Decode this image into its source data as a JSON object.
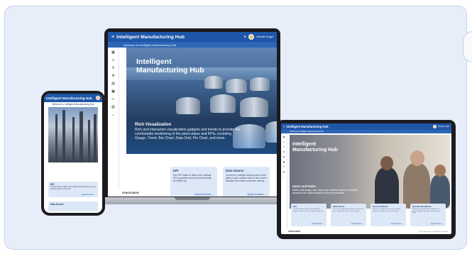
{
  "app": {
    "title": "Intelligent Manufacturing Hub",
    "welcome": "Welcome to Intelligent Manufacturing Hub",
    "user": "Jennifer Angel",
    "brand": "SYNCFUSION"
  },
  "laptop": {
    "sidebar_icons": [
      "▦",
      "⚠",
      "↯",
      "⚙",
      "▤",
      "▣",
      "⊢",
      "▥",
      "⌄"
    ],
    "hero_title": [
      "Intelligent",
      "Manufacturing Hub"
    ],
    "caption_title": "Rich Visualization",
    "caption_desc": "Rich and interactive visualization gadgets and trends to provide the comfortable monitoring of the plant status and KPIs, including Gauge, Trend, Bar Chart, Data Grid, Pie Chart, and more.",
    "cards": [
      {
        "title": "KPI",
        "desc": "Use KPI editor to define and validate KPI properties such as process limits for better ide.",
        "more": "Quick Access →"
      },
      {
        "title": "Data Source",
        "desc": "Connect to multiple data sources in the plant to get a unified view of the current situation and make corrective actions.",
        "more": "Quick Access →"
      }
    ]
  },
  "phone": {
    "title": "Intelligent Manufacturing Hub",
    "welcome": "Welcome to Intelligent Manufacturing Hub",
    "cards": [
      {
        "title": "KPI",
        "desc": "Use KPI editor to define and validate KPI properties such as process limits for better ide.",
        "more": "Quick Access →"
      },
      {
        "title": "Data Source",
        "desc": "",
        "more": ""
      }
    ]
  },
  "tablet": {
    "hero_title": [
      "Intelligent",
      "Manufacturing Hub"
    ],
    "caption_title": "Users and Roles",
    "caption_desc": "Define and assign user roles in an intuitive manner to provide access to the system based on their permissions.",
    "cards": [
      {
        "title": "KPI",
        "desc": "Use KPI editor to define and validate KPI properties such as process limits for better ide.",
        "more": "Quick Access →"
      },
      {
        "title": "Data Source",
        "desc": "Connect to multiple data sources in the plant to get a unified view of the current situation.",
        "more": "Quick Access →"
      },
      {
        "title": "Users and Roles",
        "desc": "Define and assign user roles in an intuitive manner to provide access to the system.",
        "more": "Quick Access →"
      },
      {
        "title": "Dynamic Workflows",
        "desc": "Build dynamic and flexible workflows with actions triggered by events occurring in the plant.",
        "more": "Quick Access →"
      }
    ],
    "copyright": "© 2023 Syncfusion Inc. All Rights Reserved."
  },
  "colors": {
    "accent": "#1f57a8",
    "frame": "#e7eefa",
    "card": "#dde8f7"
  }
}
